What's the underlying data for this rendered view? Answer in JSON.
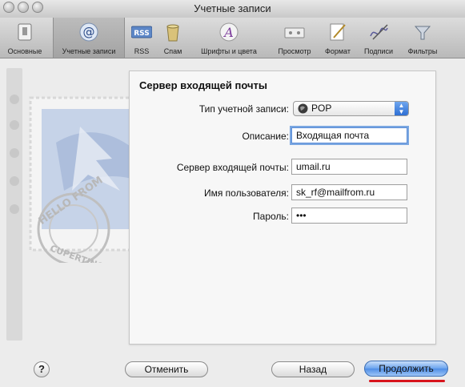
{
  "window": {
    "title": "Учетные записи"
  },
  "toolbar": {
    "items": [
      {
        "label": "Основные",
        "icon": "switch-icon"
      },
      {
        "label": "Учетные записи",
        "icon": "at-icon",
        "selected": true
      },
      {
        "label": "RSS",
        "icon": "rss-icon"
      },
      {
        "label": "Спам",
        "icon": "junk-icon"
      },
      {
        "label": "Шрифты и цвета",
        "icon": "fonts-icon"
      },
      {
        "label": "Просмотр",
        "icon": "viewing-icon"
      },
      {
        "label": "Формат",
        "icon": "composing-icon"
      },
      {
        "label": "Подписи",
        "icon": "signatures-icon"
      },
      {
        "label": "Фильтры",
        "icon": "rules-icon"
      }
    ]
  },
  "stamp": {
    "postmark_top": "HELLO FROM",
    "postmark_bottom": "CUPERTINO, CA"
  },
  "form": {
    "heading": "Сервер входящей почты",
    "account_type_label": "Тип учетной записи:",
    "account_type_value": "POP",
    "description_label": "Описание:",
    "description_value": "Входящая почта",
    "server_label": "Сервер входящей почты:",
    "server_value": "umail.ru",
    "username_label": "Имя пользователя:",
    "username_value": "sk_rf@mailfrom.ru",
    "password_label": "Пароль:",
    "password_value": "•••"
  },
  "buttons": {
    "help": "?",
    "cancel": "Отменить",
    "back": "Назад",
    "continue": "Продолжить"
  },
  "colors": {
    "accent": "#4e8ee6",
    "highlight": "#d8141c"
  }
}
